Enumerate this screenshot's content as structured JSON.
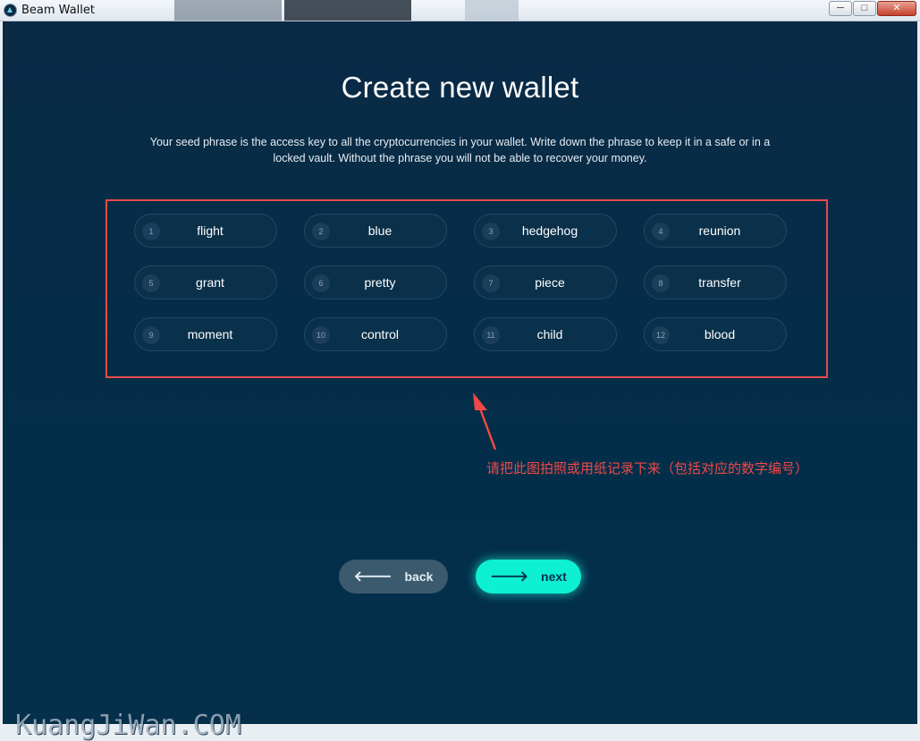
{
  "window": {
    "title": "Beam Wallet",
    "controls": {
      "minimize": "─",
      "maximize": "□",
      "close": "✕"
    }
  },
  "page": {
    "heading": "Create new wallet",
    "description": "Your seed phrase is the access key to all the cryptocurrencies in your wallet. Write down the phrase to keep it in a safe or in a locked vault. Without the phrase you will not be able to recover your money."
  },
  "seed_words": [
    {
      "num": "1",
      "word": "flight"
    },
    {
      "num": "2",
      "word": "blue"
    },
    {
      "num": "3",
      "word": "hedgehog"
    },
    {
      "num": "4",
      "word": "reunion"
    },
    {
      "num": "5",
      "word": "grant"
    },
    {
      "num": "6",
      "word": "pretty"
    },
    {
      "num": "7",
      "word": "piece"
    },
    {
      "num": "8",
      "word": "transfer"
    },
    {
      "num": "9",
      "word": "moment"
    },
    {
      "num": "10",
      "word": "control"
    },
    {
      "num": "11",
      "word": "child"
    },
    {
      "num": "12",
      "word": "blood"
    }
  ],
  "annotation": {
    "text": "请把此图拍照或用纸记录下来（包括对应的数字编号）",
    "color": "#f04848"
  },
  "buttons": {
    "back": {
      "label": "back",
      "icon": "arrow-left-icon",
      "glyph": "🡐"
    },
    "next": {
      "label": "next",
      "icon": "arrow-right-icon",
      "glyph": "🡒"
    }
  },
  "colors": {
    "background": "#032e49",
    "accent": "#0df0d2",
    "back_button": "#3b5a6d"
  },
  "watermark": "KuangJiWan.COM"
}
